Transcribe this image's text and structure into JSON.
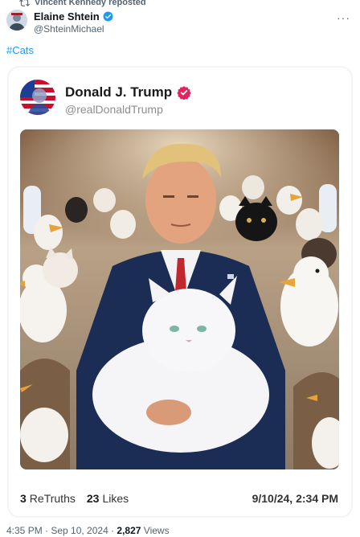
{
  "repost": {
    "label": "Vincent Kennedy reposted"
  },
  "author": {
    "name": "Elaine Shtein",
    "handle": "@ShteinMichael"
  },
  "more": {
    "label": "···"
  },
  "post": {
    "hashtag": "#Cats"
  },
  "truth": {
    "name": "Donald J. Trump",
    "handle": "@realDonaldTrump",
    "retruths_count": "3",
    "retruths_label": "ReTruths",
    "likes_count": "23",
    "likes_label": "Likes",
    "date": "9/10/24, 2:34 PM"
  },
  "footer": {
    "time": "4:35 PM · Sep 10, 2024 · ",
    "views_count": "2,827",
    "views_label": " Views"
  },
  "colors": {
    "link": "#1d9bf0",
    "verified_x": "#1d9bf0",
    "verified_truth": "#e0245e"
  }
}
